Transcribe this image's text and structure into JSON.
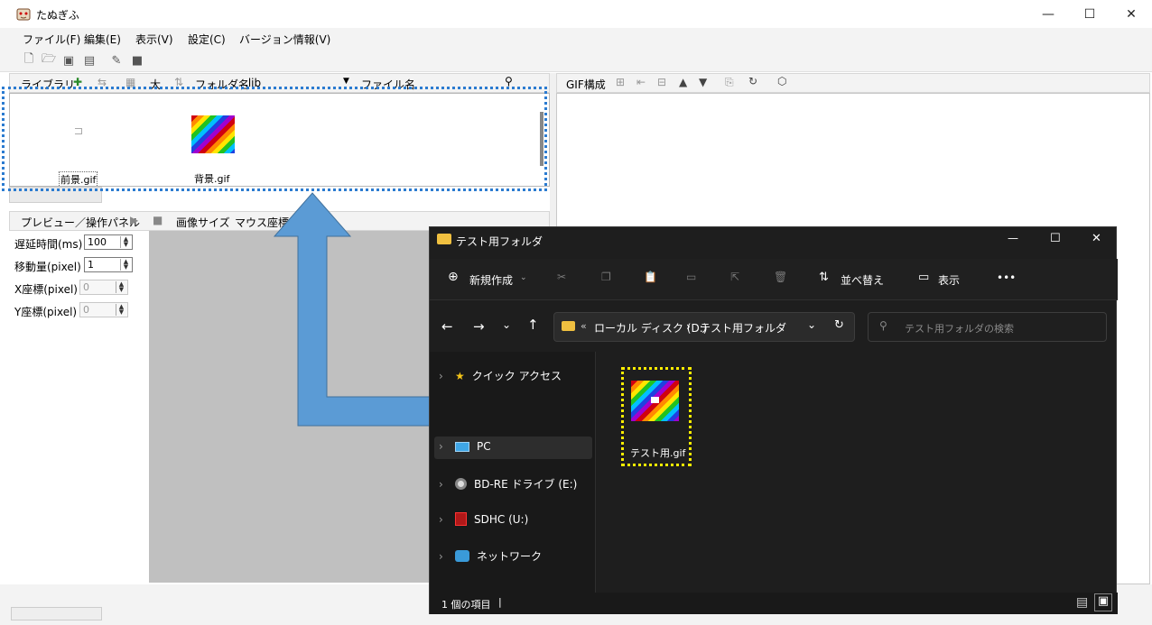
{
  "app": {
    "title": "たぬぎふ",
    "window_controls": {
      "minimize": "—",
      "maximize": "☐",
      "close": "✕"
    }
  },
  "menu": [
    "ファイル(F)",
    "編集(E)",
    "表示(V)",
    "設定(C)",
    "バージョン情報(V)"
  ],
  "library": {
    "toolbar": {
      "label": "ライブラリ",
      "size_label": "大",
      "folder_label": "フォルダ名",
      "folder_value": ".lib",
      "file_label": "ファイル名"
    },
    "items": [
      {
        "name": "前景.gif"
      },
      {
        "name": "背景.gif"
      }
    ]
  },
  "preview": {
    "toolbar": {
      "label": "プレビュー／操作パネル",
      "image_size": "画像サイズ",
      "mouse_coords": "マウス座標"
    },
    "params": [
      {
        "label": "遅延時間(ms)",
        "value": "100",
        "enabled": true
      },
      {
        "label": "移動量(pixel)",
        "value": "1",
        "enabled": true
      },
      {
        "label": "X座標(pixel)",
        "value": "0",
        "enabled": false
      },
      {
        "label": "Y座標(pixel)",
        "value": "0",
        "enabled": false
      }
    ]
  },
  "gif_panel": {
    "label": "GIF構成"
  },
  "explorer": {
    "title": "テスト用フォルダ",
    "window_controls": {
      "minimize": "—",
      "maximize": "☐",
      "close": "✕"
    },
    "toolbar": {
      "new": "新規作成",
      "sort": "並べ替え",
      "view": "表示",
      "more": "•••"
    },
    "address": {
      "prefix": "«",
      "drive": "ローカル ディスク (D:)",
      "sep": "›",
      "folder": "テスト用フォルダ"
    },
    "search_placeholder": "テスト用フォルダの検索",
    "nav": [
      {
        "label": "クイック アクセス",
        "icon": "star-icon"
      },
      {
        "label": "PC",
        "icon": "monitor-icon"
      },
      {
        "label": "BD-RE ドライブ (E:)",
        "icon": "disc-icon"
      },
      {
        "label": "SDHC (U:)",
        "icon": "sd-card-icon"
      },
      {
        "label": "ネットワーク",
        "icon": "network-icon"
      }
    ],
    "file": {
      "name": "テスト用.gif"
    },
    "status": "1 個の項目",
    "status_cursor": "|"
  }
}
